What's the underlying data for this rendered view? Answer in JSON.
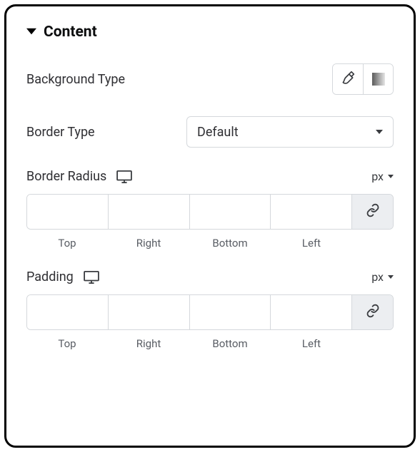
{
  "section": {
    "title": "Content"
  },
  "backgroundType": {
    "label": "Background Type"
  },
  "borderType": {
    "label": "Border Type",
    "value": "Default"
  },
  "borderRadius": {
    "label": "Border Radius",
    "unit": "px",
    "top": "",
    "right": "",
    "bottom": "",
    "left": "",
    "labels": {
      "top": "Top",
      "right": "Right",
      "bottom": "Bottom",
      "left": "Left"
    }
  },
  "padding": {
    "label": "Padding",
    "unit": "px",
    "top": "",
    "right": "",
    "bottom": "",
    "left": "",
    "labels": {
      "top": "Top",
      "right": "Right",
      "bottom": "Bottom",
      "left": "Left"
    }
  }
}
